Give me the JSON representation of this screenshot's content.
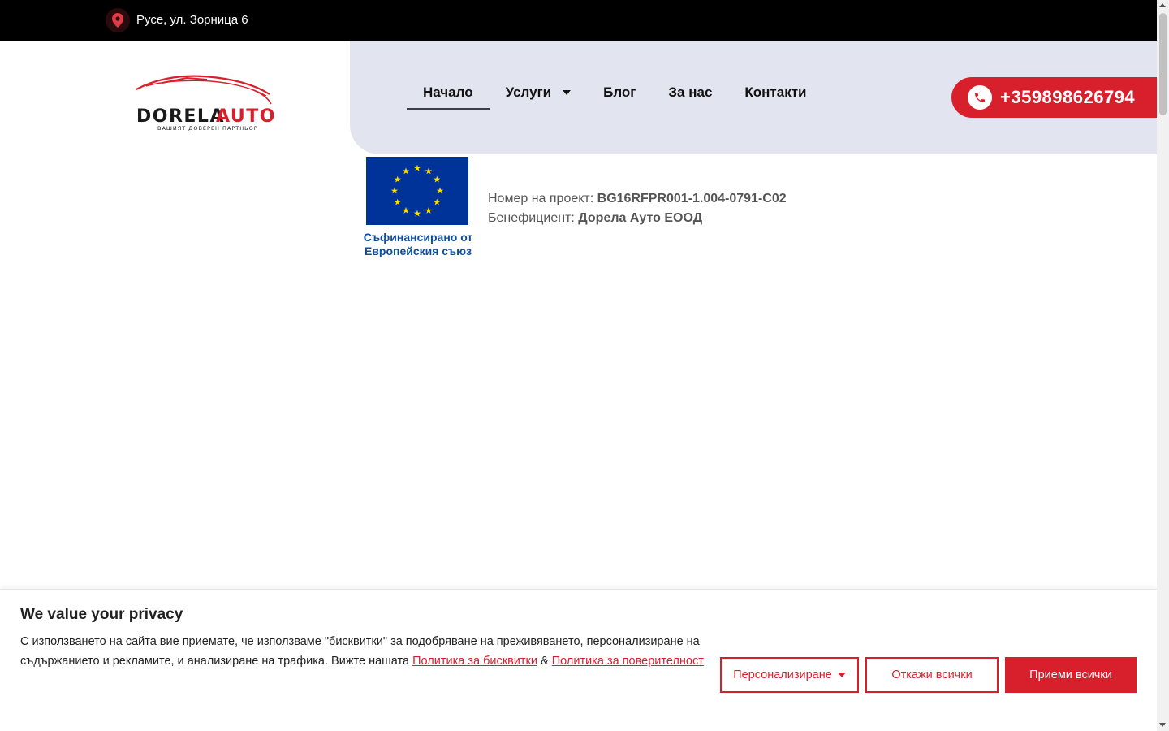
{
  "topbar": {
    "location_icon": "map-pin-icon",
    "address": "Русе, ул. Зорница 6"
  },
  "logo": {
    "brand_left": "DORELA",
    "brand_right": "AUTO",
    "tagline": "ВАШИЯТ ДОВЕРЕН ПАРТНЬОР"
  },
  "nav": {
    "items": [
      {
        "label": "Начало"
      },
      {
        "label": "Услуги"
      },
      {
        "label": "Блог"
      },
      {
        "label": "За нас"
      },
      {
        "label": "Контакти"
      }
    ]
  },
  "phone": {
    "icon": "phone-icon",
    "number": "+359898626794"
  },
  "eu": {
    "caption_line1": "Съфинансирано от",
    "caption_line2": "Европейския съюз",
    "project_label": "Номер на проект:",
    "project_value": "BG16RFPR001-1.004-0791-C02",
    "beneficiary_label": "Бенефициент:",
    "beneficiary_value": "Дорела Ауто ЕООД"
  },
  "cookie": {
    "title": "We value your privacy",
    "text": "С използването на сайта вие приемате, че използваме \"бисквитки\" за подобряване на преживяването, персонализиране на съдържанието и рекламите, и анализиране на трафика. Вижте нашата",
    "link_cookies": "Политика за бисквитки",
    "amp": "&",
    "link_privacy": "Политика за поверителност",
    "btn_customize": "Персонализиране",
    "btn_reject": "Откажи всички",
    "btn_accept": "Приеми всички"
  },
  "colors": {
    "brand_red": "#d8202c",
    "nav_bg": "#e2e5f0",
    "eu_blue": "#003399",
    "eu_star": "#ffdd00"
  }
}
